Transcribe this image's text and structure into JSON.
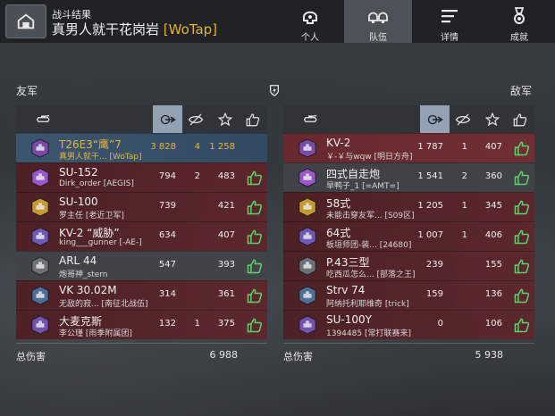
{
  "header": {
    "subtitle": "战斗结果",
    "player": "真男人就干花岗岩",
    "clan": "[WoTap]",
    "tabs": [
      {
        "label": "个人",
        "icon": "helmet-icon",
        "active": false
      },
      {
        "label": "队伍",
        "icon": "team-icon",
        "active": true
      },
      {
        "label": "详情",
        "icon": "list-icon",
        "active": false
      },
      {
        "label": "成就",
        "icon": "medal-icon",
        "active": false
      }
    ]
  },
  "allies": {
    "title": "友军",
    "total_label": "总伤害",
    "total": "6 988",
    "rows": [
      {
        "tank": "T26E3“鹰”7",
        "player": "真男人就干...  [WoTap]",
        "damage": "3 828",
        "kills": "4",
        "spotting": "1 258",
        "style": "hl"
      },
      {
        "tank": "SU-152",
        "player": "Dirk_order [AEGIS]",
        "damage": "794",
        "kills": "2",
        "spotting": "483",
        "style": "red"
      },
      {
        "tank": "SU-100",
        "player": "罗主任 [老近卫军]",
        "damage": "739",
        "kills": "",
        "spotting": "421",
        "style": "red"
      },
      {
        "tank": "KV-2 “威胁”",
        "player": "king___gunner [-AE-]",
        "damage": "634",
        "kills": "",
        "spotting": "407",
        "style": "red"
      },
      {
        "tank": "ARL 44",
        "player": "炮哥神_stern",
        "damage": "547",
        "kills": "",
        "spotting": "393",
        "style": "gray"
      },
      {
        "tank": "VK 30.02M",
        "player": "无敌的寂... [南征北战伍]",
        "damage": "314",
        "kills": "",
        "spotting": "361",
        "style": "red"
      },
      {
        "tank": "大麦克斯",
        "player": "李公瑾 [雨季附属团]",
        "damage": "132",
        "kills": "1",
        "spotting": "375",
        "style": "red"
      }
    ]
  },
  "enemies": {
    "title": "敌军",
    "total_label": "总伤害",
    "total": "5 938",
    "rows": [
      {
        "tank": "KV-2",
        "player": "￥-￥与wqw [明日方舟]",
        "damage": "1 787",
        "kills": "1",
        "spotting": "407",
        "style": "hl-red"
      },
      {
        "tank": "四式自走炮",
        "player": "旱鸭子_1 [=AMT=]",
        "damage": "1 541",
        "kills": "2",
        "spotting": "360",
        "style": "gray"
      },
      {
        "tank": "58式",
        "player": "未能击穿友军...  [S09区]",
        "damage": "1 205",
        "kills": "1",
        "spotting": "345",
        "style": "red"
      },
      {
        "tank": "64式",
        "player": "板垣师团-装...  [24680]",
        "damage": "1 007",
        "kills": "1",
        "spotting": "406",
        "style": "red"
      },
      {
        "tank": "P.43三型",
        "player": "吃西瓜怎么... [部落之王]",
        "damage": "239",
        "kills": "",
        "spotting": "155",
        "style": "red"
      },
      {
        "tank": "Strv 74",
        "player": "阿纳托利耶维奇 [trick]",
        "damage": "159",
        "kills": "",
        "spotting": "136",
        "style": "red"
      },
      {
        "tank": "SU-100Y",
        "player": "1394485 [常打联赛来]",
        "damage": "0",
        "kills": "",
        "spotting": "106",
        "style": "red"
      }
    ]
  },
  "colors": {
    "accent_gold": "#e6b22f",
    "like_green": "#5fd16a",
    "row_red": "#5a2226",
    "row_highlight": "#3c5c78",
    "selected_col": "#93a2b2"
  }
}
